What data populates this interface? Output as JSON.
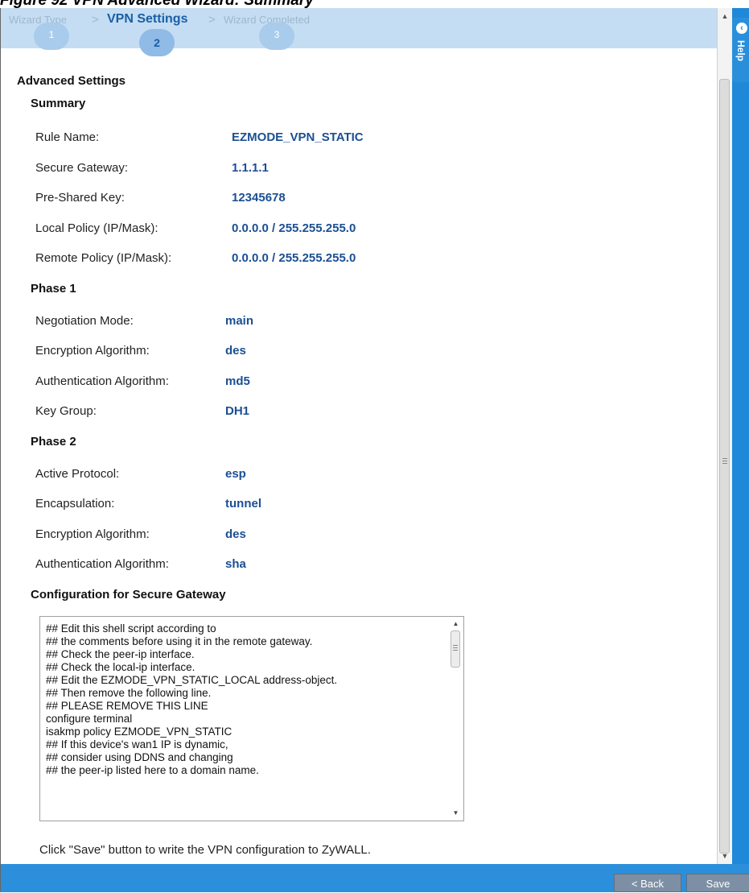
{
  "caption": "Figure 92   VPN Advanced Wizard: Summary",
  "wizard": {
    "steps": [
      {
        "label": "Wizard Type",
        "number": "1"
      },
      {
        "label": "VPN Settings",
        "number": "2"
      },
      {
        "label": "Wizard Completed",
        "number": "3"
      }
    ],
    "separator": ">"
  },
  "help": {
    "label": "Help"
  },
  "advanced_title": "Advanced Settings",
  "summary": {
    "heading": "Summary",
    "rows": [
      {
        "label": "Rule Name:",
        "value": "EZMODE_VPN_STATIC"
      },
      {
        "label": "Secure Gateway:",
        "value": "1.1.1.1"
      },
      {
        "label": "Pre-Shared Key:",
        "value": "12345678"
      },
      {
        "label": "Local Policy (IP/Mask):",
        "value": "0.0.0.0 / 255.255.255.0"
      },
      {
        "label": "Remote Policy (IP/Mask):",
        "value": "0.0.0.0 / 255.255.255.0"
      }
    ]
  },
  "phase1": {
    "heading": "Phase 1",
    "rows": [
      {
        "label": "Negotiation Mode:",
        "value": "main"
      },
      {
        "label": "Encryption Algorithm:",
        "value": "des"
      },
      {
        "label": "Authentication Algorithm:",
        "value": "md5"
      },
      {
        "label": "Key Group:",
        "value": "DH1"
      }
    ]
  },
  "phase2": {
    "heading": "Phase 2",
    "rows": [
      {
        "label": "Active Protocol:",
        "value": "esp"
      },
      {
        "label": "Encapsulation:",
        "value": "tunnel"
      },
      {
        "label": "Encryption Algorithm:",
        "value": "des"
      },
      {
        "label": "Authentication Algorithm:",
        "value": "sha"
      }
    ]
  },
  "config": {
    "heading": "Configuration for Secure Gateway",
    "lines": [
      "## Edit this shell script according to",
      "## the comments before using it in the remote gateway.",
      "## Check the peer-ip interface.",
      "## Check the local-ip interface.",
      "## Edit the EZMODE_VPN_STATIC_LOCAL address-object.",
      "## Then remove the following line.",
      "## PLEASE REMOVE THIS LINE",
      "configure terminal",
      "isakmp policy EZMODE_VPN_STATIC",
      "## If this device's wan1 IP is dynamic,",
      "## consider using DDNS and changing",
      "## the peer-ip listed here to a domain name."
    ]
  },
  "footer_note": "Click \"Save\" button to write the VPN configuration to ZyWALL.",
  "buttons": {
    "back": "< Back",
    "save": "Save"
  }
}
